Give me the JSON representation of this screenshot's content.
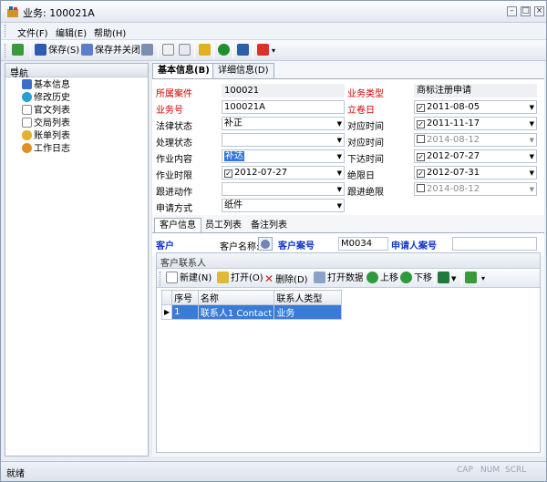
{
  "window": {
    "title": "业务: 100021A"
  },
  "menu": [
    "文件(F)",
    "编辑(E)",
    "帮助(H)"
  ],
  "toolbar": {
    "save": "保存(S)",
    "save_close": "保存并关闭"
  },
  "nav": {
    "header": "导航",
    "items": [
      "基本信息",
      "修改历史",
      "官文列表",
      "交局列表",
      "账单列表",
      "工作日志"
    ]
  },
  "tabs": {
    "basic": "基本信息(B)",
    "detail": "详细信息(D)"
  },
  "form": {
    "case_label": "所属案件",
    "case_value": "100021",
    "biz_type_label": "业务类型",
    "biz_type_value": "商标注册申请",
    "biz_no_label": "业务号",
    "biz_no_value": "100021A",
    "filing_date_label": "立卷日",
    "filing_date_value": "2011-08-05",
    "legal_status_label": "法律状态",
    "legal_status_value": "补正",
    "due_time_label": "对应时间",
    "due_time_value": "2011-11-17",
    "proc_status_label": "处理状态",
    "proc_status_value": "",
    "due_time2_label": "对应时间",
    "due_time2_value": "2014-08-12",
    "work_label": "作业内容",
    "work_value": "补达",
    "issue_time_label": "下达时间",
    "issue_time_value": "2012-07-27",
    "work_deadline_label": "作业时限",
    "work_deadline_value": "2012-07-27",
    "abs_deadline_label": "绝限日",
    "abs_deadline_value": "2012-07-31",
    "followup_label": "跟进动作",
    "followup_value": "",
    "followup_abs_label": "跟进绝限",
    "followup_abs_value": "2014-08-12",
    "apply_method_label": "申请方式",
    "apply_method_value": "纸件"
  },
  "subtabs": [
    "客户信息",
    "员工列表",
    "备注列表"
  ],
  "customer": {
    "label": "客户",
    "name_label": "客户名称:",
    "case_no_label": "客户案号",
    "case_no_value": "M0034",
    "applicant_case_label": "申请人案号",
    "applicant_case_value": ""
  },
  "contacts": {
    "header": "客户联系人",
    "toolbar": {
      "new": "新建(N)",
      "open": "打开(O)",
      "delete": "删除(D)",
      "open_data": "打开数据",
      "up": "上移",
      "down": "下移"
    },
    "columns": [
      "序号",
      "名称",
      "联系人类型"
    ],
    "rows": [
      {
        "no": "1",
        "name": "联系人1 Contact",
        "type": "业务"
      }
    ]
  },
  "status": {
    "text": "就绪",
    "caps": "CAP",
    "num": "NUM",
    "scrl": "SCRL"
  }
}
